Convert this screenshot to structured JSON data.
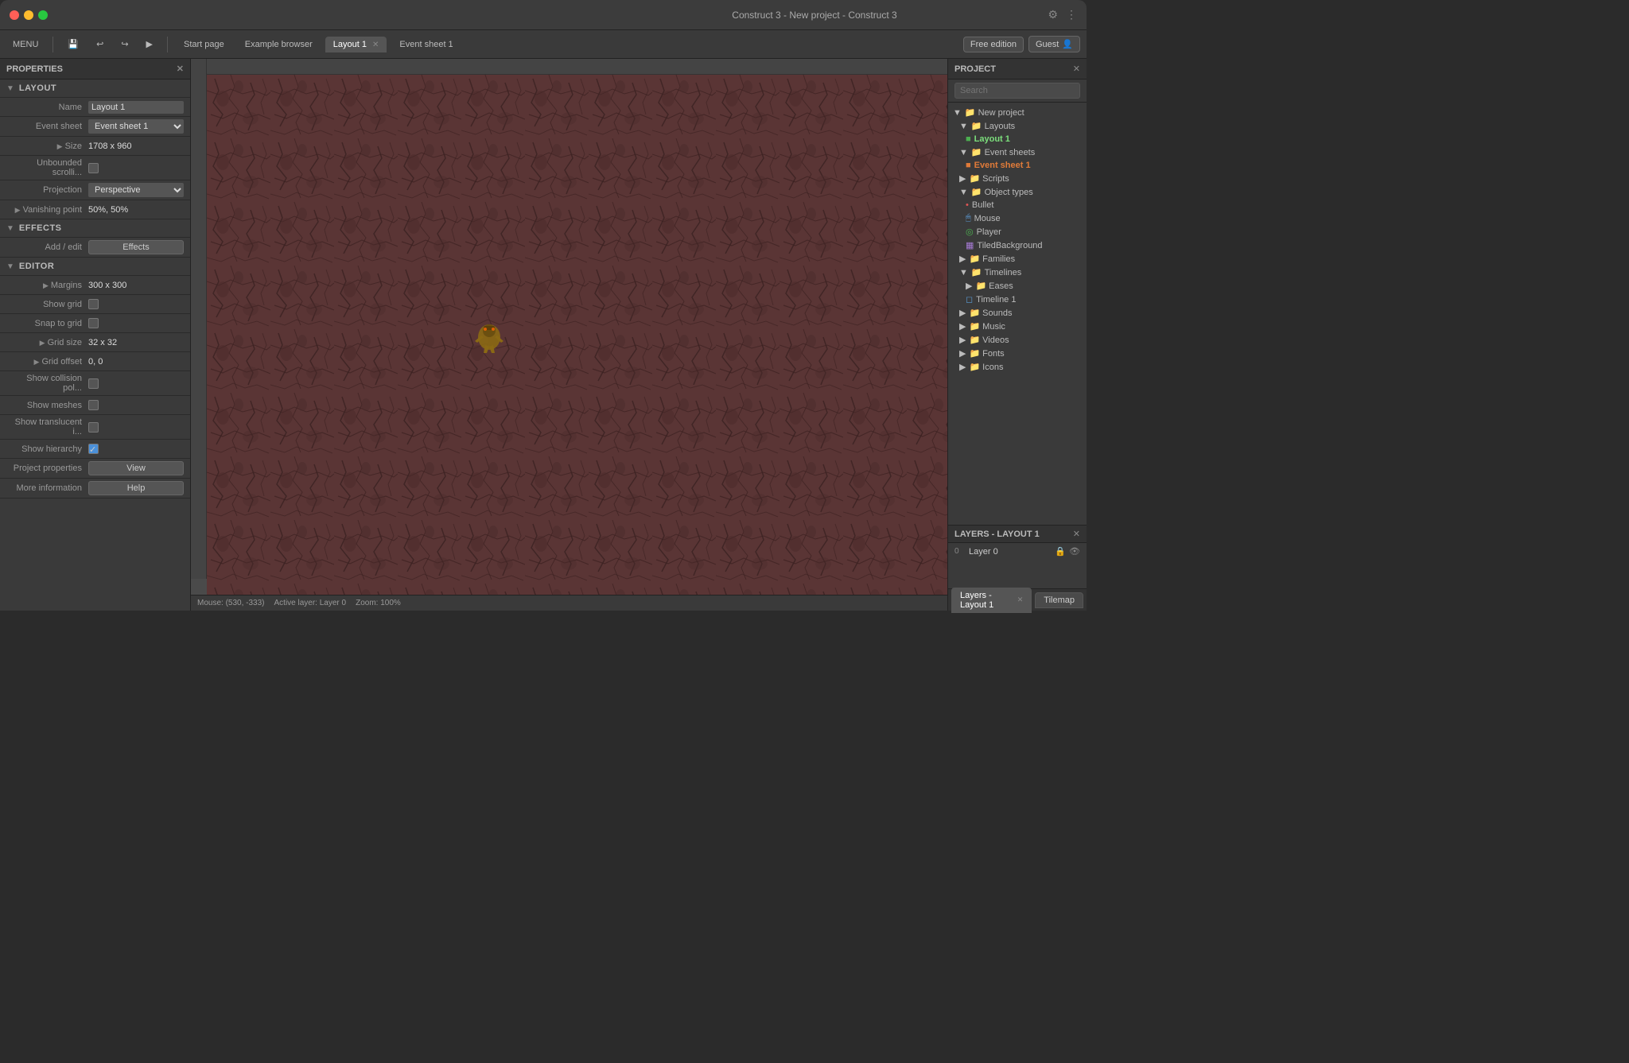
{
  "window": {
    "title": "Construct 3 - New project - Construct 3",
    "traffic_lights": [
      "red",
      "yellow",
      "green"
    ]
  },
  "toolbar": {
    "menu_label": "MENU",
    "tabs": [
      {
        "label": "Start page",
        "active": false,
        "closable": false
      },
      {
        "label": "Example browser",
        "active": false,
        "closable": false
      },
      {
        "label": "Layout 1",
        "active": true,
        "closable": true
      },
      {
        "label": "Event sheet 1",
        "active": false,
        "closable": false
      }
    ],
    "free_edition_label": "Free edition",
    "guest_label": "Guest"
  },
  "properties": {
    "title": "PROPERTIES",
    "sections": {
      "layout": {
        "title": "LAYOUT",
        "fields": {
          "name_label": "Name",
          "name_value": "Layout 1",
          "event_sheet_label": "Event sheet",
          "event_sheet_value": "Event sheet 1",
          "size_label": "Size",
          "size_value": "1708 x 960",
          "unbounded_scroll_label": "Unbounded scrolli...",
          "projection_label": "Projection",
          "projection_value": "Perspective",
          "vanishing_point_label": "Vanishing point",
          "vanishing_point_value": "50%, 50%"
        }
      },
      "effects": {
        "title": "EFFECTS",
        "add_edit_label": "Add / edit",
        "effects_btn_label": "Effects"
      },
      "editor": {
        "title": "EDITOR",
        "fields": {
          "margins_label": "Margins",
          "margins_value": "300 x 300",
          "show_grid_label": "Show grid",
          "snap_to_grid_label": "Snap to grid",
          "grid_size_label": "Grid size",
          "grid_size_value": "32 x 32",
          "grid_offset_label": "Grid offset",
          "grid_offset_value": "0, 0",
          "show_collision_label": "Show collision pol...",
          "show_meshes_label": "Show meshes",
          "show_translucent_label": "Show translucent i...",
          "show_hierarchy_label": "Show hierarchy",
          "project_properties_label": "Project properties",
          "view_btn_label": "View",
          "more_info_label": "More information",
          "help_btn_label": "Help"
        }
      }
    }
  },
  "project": {
    "title": "PROJECT",
    "search_placeholder": "Search",
    "tree": [
      {
        "label": "New project",
        "type": "folder",
        "indent": 0
      },
      {
        "label": "Layouts",
        "type": "folder",
        "indent": 1
      },
      {
        "label": "Layout 1",
        "type": "file-green",
        "indent": 2,
        "active": true
      },
      {
        "label": "Event sheets",
        "type": "folder",
        "indent": 1
      },
      {
        "label": "Event sheet 1",
        "type": "file-orange",
        "indent": 2,
        "active": true
      },
      {
        "label": "Scripts",
        "type": "folder",
        "indent": 1
      },
      {
        "label": "Object types",
        "type": "folder",
        "indent": 1
      },
      {
        "label": "Bullet",
        "type": "file-red",
        "indent": 2
      },
      {
        "label": "Mouse",
        "type": "file-blue",
        "indent": 2
      },
      {
        "label": "Player",
        "type": "file-green",
        "indent": 2
      },
      {
        "label": "TiledBackground",
        "type": "file-purple",
        "indent": 2
      },
      {
        "label": "Families",
        "type": "folder",
        "indent": 1
      },
      {
        "label": "Timelines",
        "type": "folder",
        "indent": 1
      },
      {
        "label": "Eases",
        "type": "folder",
        "indent": 2
      },
      {
        "label": "Timeline 1",
        "type": "file-blue",
        "indent": 2
      },
      {
        "label": "Sounds",
        "type": "folder",
        "indent": 1
      },
      {
        "label": "Music",
        "type": "folder",
        "indent": 1
      },
      {
        "label": "Videos",
        "type": "folder",
        "indent": 1
      },
      {
        "label": "Fonts",
        "type": "folder",
        "indent": 1
      },
      {
        "label": "Icons",
        "type": "folder",
        "indent": 1
      }
    ]
  },
  "layers": {
    "title": "LAYERS - LAYOUT 1",
    "items": [
      {
        "num": "0",
        "name": "Layer 0"
      }
    ]
  },
  "statusbar": {
    "mouse": "Mouse: (530, -333)",
    "active_layer": "Active layer: Layer 0",
    "zoom": "Zoom: 100%"
  },
  "bottom_tabs": [
    {
      "label": "Layers - Layout 1",
      "active": true,
      "closable": true
    },
    {
      "label": "Tilemap",
      "active": false,
      "closable": false
    }
  ],
  "icons": {
    "folder": "📁",
    "arrow_down": "▼",
    "arrow_right": "▶",
    "close": "✕",
    "lock": "🔒",
    "eye": "👁",
    "settings": "⚙",
    "menu_dots": "⋮"
  }
}
